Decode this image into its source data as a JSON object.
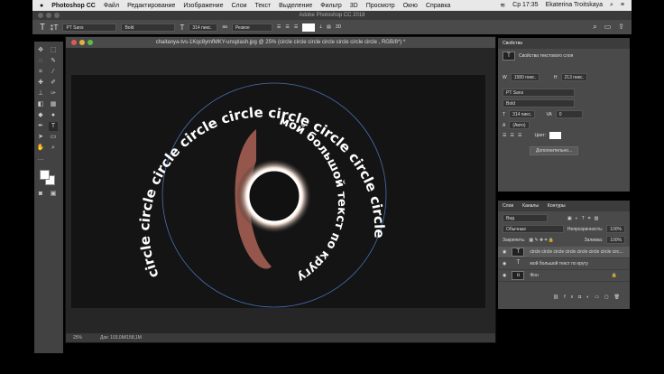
{
  "menubar": {
    "app": "Photoshop CC",
    "items": [
      "Файл",
      "Редактирование",
      "Изображение",
      "Слои",
      "Текст",
      "Выделение",
      "Фильтр",
      "3D",
      "Просмотр",
      "Окно",
      "Справка"
    ],
    "clock": "Ср 17:35",
    "user": "Ekaterina Troitskaya"
  },
  "window_title": "Adobe Photoshop CC 2018",
  "options": {
    "font": "PT Sans",
    "style": "Bold",
    "size": "314 пикс.",
    "aa": "Резкое"
  },
  "document": {
    "title": "chaitanya-tvs-1Kqc8ymfMKY-unsplash.jpg @ 25% (circle circle circle circle circle circle circle , RGB/8*) *",
    "zoom": "25%",
    "doc_info": "Док: 103,0M/158,1M"
  },
  "artwork": {
    "outer_text": "circle circle circle circle circle circle circle circle circle circle circle",
    "inner_text": "мой большой текст по кругу"
  },
  "properties": {
    "tab": "Свойства",
    "header": "Свойства текстового слоя",
    "w": "1580 пикс.",
    "h": "213 пикс.",
    "font": "PT Sans",
    "style": "Bold",
    "size": "314 пикс.",
    "tracking": "0",
    "leading": "(Авто)",
    "color_label": "Цвет:",
    "more": "Дополнительно..."
  },
  "layers": {
    "tabs": [
      "Слои",
      "Каналы",
      "Контуры"
    ],
    "filter": "Вид",
    "blend": "Обычные",
    "opacity_label": "Непрозрачность:",
    "opacity": "100%",
    "lock_label": "Закрепить:",
    "fill_label": "Заливка:",
    "fill": "100%",
    "items": [
      {
        "name": "circle circle circle circle circle circle circle circ...",
        "thumb": "T"
      },
      {
        "name": "мой большой текст по кругу",
        "thumb": "T"
      },
      {
        "name": "Фон",
        "thumb": "o"
      }
    ]
  }
}
